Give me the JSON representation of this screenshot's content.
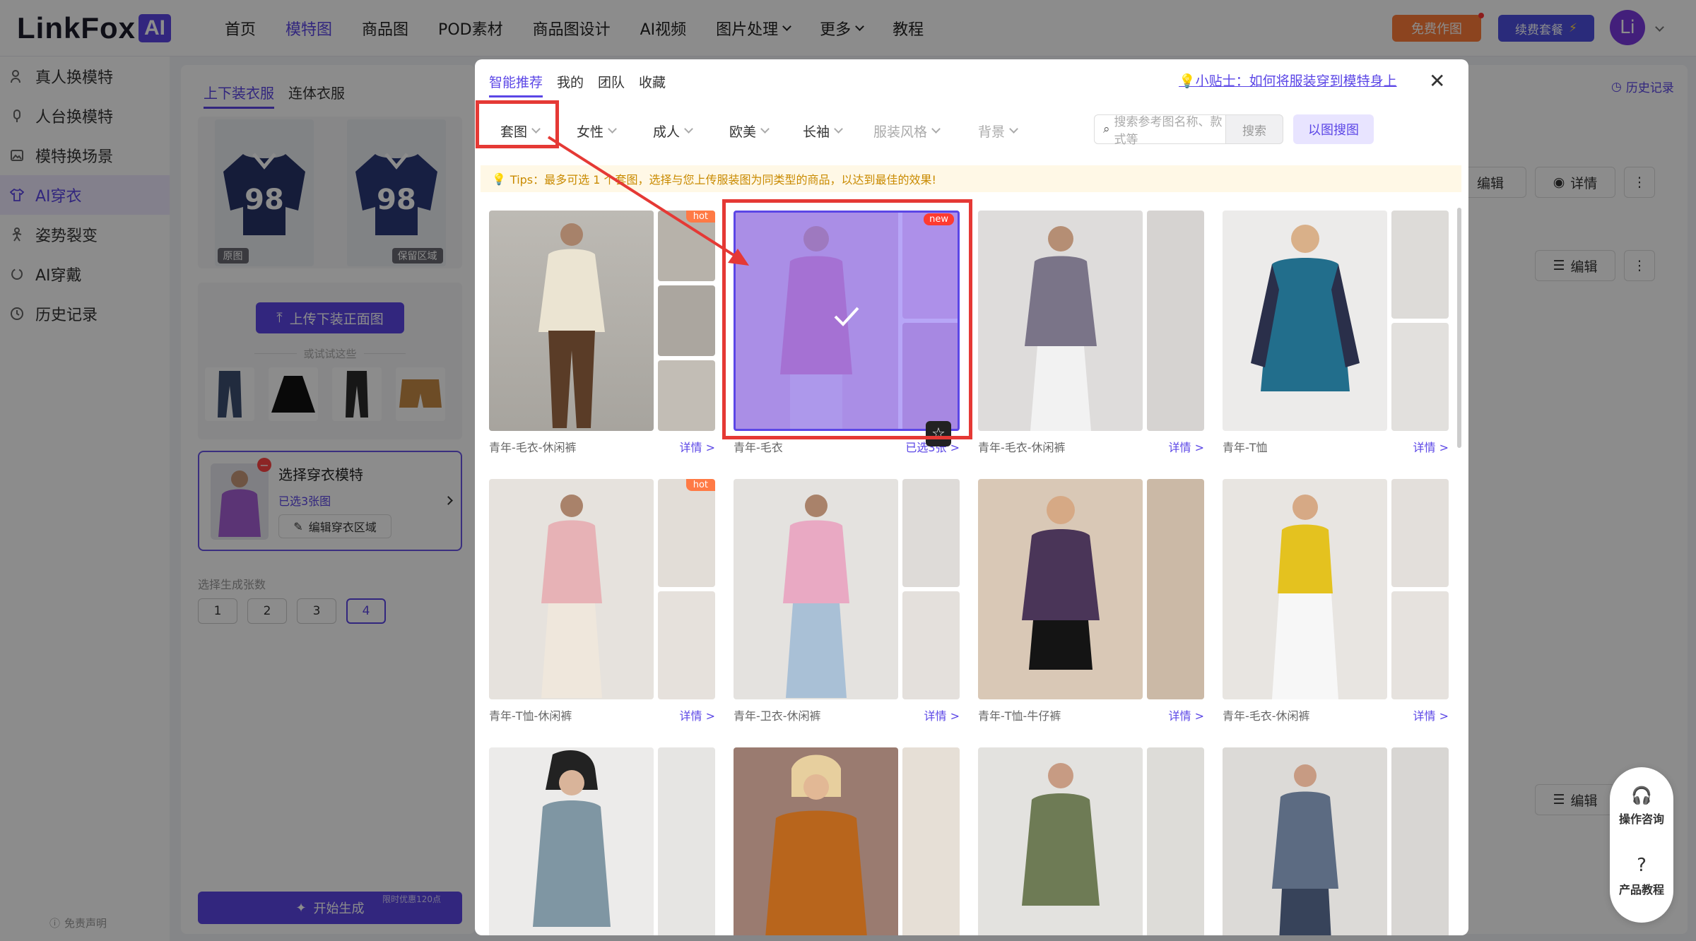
{
  "header": {
    "logo_text": "LinkFox",
    "logo_badge": "AI",
    "nav": [
      "首页",
      "模特图",
      "商品图",
      "POD素材",
      "商品图设计",
      "AI视频",
      "图片处理",
      "更多",
      "教程"
    ],
    "free_btn": "免费作图",
    "renew_btn": "续费套餐",
    "avatar": "Li"
  },
  "sidebar": {
    "items": [
      "真人换模特",
      "人台换模特",
      "模特换场景",
      "AI穿衣",
      "姿势裂变",
      "AI穿戴",
      "历史记录"
    ],
    "active": "AI穿衣",
    "disclaimer": "免责声明"
  },
  "config": {
    "tabs": [
      "上下装衣服",
      "连体衣服"
    ],
    "tag_original": "原图",
    "tag_keep": "保留区域",
    "upload_btn": "上传下装正面图",
    "or_try": "或试试这些",
    "model_title": "选择穿衣模特",
    "model_selected": "已选3张图",
    "edit_area": "编辑穿衣区域",
    "count_label": "选择生成张数",
    "counts": [
      "1",
      "2",
      "3",
      "4"
    ],
    "count_selected": "4",
    "generate_btn": "开始生成",
    "promo": "限时优惠120点"
  },
  "right": {
    "history": "历史记录",
    "edit": "编辑",
    "details": "详情"
  },
  "modal": {
    "tabs": [
      "智能推荐",
      "我的",
      "团队",
      "收藏"
    ],
    "tip_link": "💡小贴士：如何将服装穿到模特身上",
    "filters": [
      "套图",
      "女性",
      "成人",
      "欧美",
      "长袖",
      "服装风格",
      "背景"
    ],
    "search_placeholder": "搜索参考图名称、款式等",
    "search_btn": "搜索",
    "image_search_btn": "以图搜图",
    "tips": "Tips：最多可选 1 个套图，选择与您上传服装图为同类型的商品，以达到最佳的效果!",
    "cards": [
      {
        "name": "青年-毛衣-休闲裤",
        "action": "详情 >",
        "badge": "hot"
      },
      {
        "name": "青年-毛衣",
        "action": "已选3张 >",
        "badge": "new",
        "selected": true
      },
      {
        "name": "青年-毛衣-休闲裤",
        "action": "详情 >"
      },
      {
        "name": "青年-T恤",
        "action": "详情 >"
      },
      {
        "name": "青年-T恤-休闲裤",
        "action": "详情 >",
        "badge": "hot"
      },
      {
        "name": "青年-卫衣-休闲裤",
        "action": "详情 >"
      },
      {
        "name": "青年-T恤-牛仔裤",
        "action": "详情 >"
      },
      {
        "name": "青年-毛衣-休闲裤",
        "action": "详情 >"
      },
      {
        "name": "",
        "action": ""
      },
      {
        "name": "",
        "action": ""
      },
      {
        "name": "",
        "action": ""
      },
      {
        "name": "",
        "action": ""
      }
    ]
  },
  "helper": {
    "consult": "操作咨询",
    "tutorial": "产品教程"
  },
  "colors": {
    "accent": "#5b46e6",
    "highlight": "#e53935",
    "selected_overlay": "#7c5cf0"
  }
}
